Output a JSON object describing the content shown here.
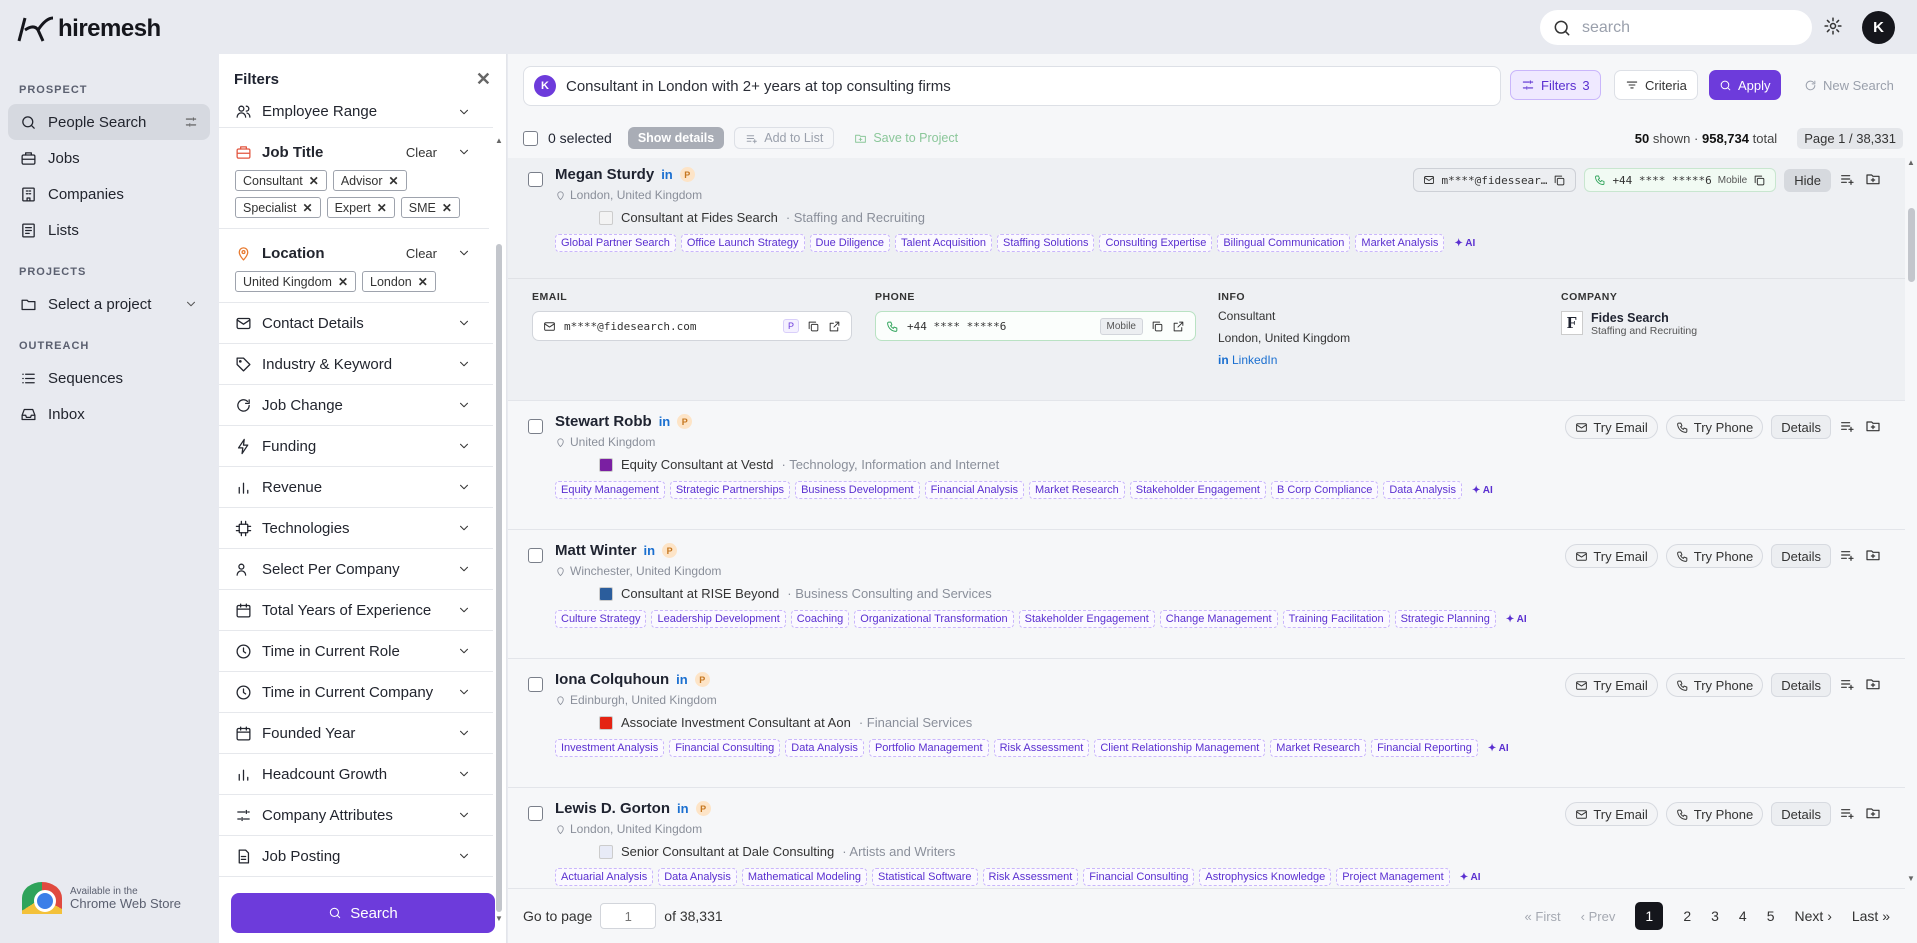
{
  "app": {
    "brand": "hiremesh",
    "avatar_initial": "K",
    "search_placeholder": "search"
  },
  "nav": {
    "sections": [
      {
        "title": "PROSPECT",
        "items": [
          "People Search",
          "Jobs",
          "Companies",
          "Lists"
        ]
      },
      {
        "title": "PROJECTS",
        "items": [
          "Select a project"
        ]
      },
      {
        "title": "OUTREACH",
        "items": [
          "Sequences",
          "Inbox"
        ]
      }
    ],
    "chrome_line1": "Available in the",
    "chrome_line2": "Chrome Web Store"
  },
  "filters": {
    "title": "Filters",
    "employee_range": "Employee Range",
    "job_title": {
      "label": "Job Title",
      "clear": "Clear",
      "chips": [
        "Consultant",
        "Advisor",
        "Specialist",
        "Expert",
        "SME"
      ]
    },
    "location": {
      "label": "Location",
      "clear": "Clear",
      "chips": [
        "United Kingdom",
        "London"
      ]
    },
    "rows": [
      "Contact Details",
      "Industry & Keyword",
      "Job Change",
      "Funding",
      "Revenue",
      "Technologies",
      "Select Per Company",
      "Total Years of Experience",
      "Time in Current Role",
      "Time in Current Company",
      "Founded Year",
      "Headcount Growth",
      "Company Attributes",
      "Job Posting"
    ],
    "search_button": "Search"
  },
  "query": {
    "initial": "K",
    "text": "Consultant in London with 2+ years at top consulting firms"
  },
  "actions": {
    "filters_label": "Filters",
    "filters_count": "3",
    "criteria": "Criteria",
    "apply": "Apply",
    "new_search": "New Search"
  },
  "toolbar": {
    "selected": "0 selected",
    "show_details": "Show details",
    "add_to_list": "Add to List",
    "save_to_project": "Save to Project",
    "shown": "50",
    "shown_suffix": "shown ·",
    "total": "958,734",
    "total_suffix": "total",
    "page": "Page 1 / 38,331"
  },
  "people": [
    {
      "name": "Megan Sturdy",
      "location": "London, United Kingdom",
      "role": "Consultant at Fides Search",
      "industry": "· Staffing and Recruiting",
      "tags": [
        "Global Partner Search",
        "Office Launch Strategy",
        "Due Diligence",
        "Talent Acquisition",
        "Staffing Solutions",
        "Consulting Expertise",
        "Bilingual Communication",
        "Market Analysis"
      ],
      "email": "m****@fidessear…",
      "phone": "+44 **** *****6",
      "phone_type": "Mobile",
      "hide": "Hide",
      "detail": {
        "email_label": "EMAIL",
        "email": "m****@fidesearch.com",
        "email_badge": "P",
        "phone_label": "PHONE",
        "phone": "+44 **** *****6",
        "phone_type": "Mobile",
        "info_label": "INFO",
        "info_title": "Consultant",
        "info_location": "London, United Kingdom",
        "info_link": "LinkedIn",
        "company_label": "COMPANY",
        "company_letter": "F",
        "company_name": "Fides Search",
        "company_industry": "Staffing and Recruiting"
      }
    },
    {
      "name": "Stewart Robb",
      "location": "United Kingdom",
      "role": "Equity Consultant at Vestd",
      "industry": "· Technology, Information and Internet",
      "tags": [
        "Equity Management",
        "Strategic Partnerships",
        "Business Development",
        "Financial Analysis",
        "Market Research",
        "Stakeholder Engagement",
        "B Corp Compliance",
        "Data Analysis"
      ]
    },
    {
      "name": "Matt Winter",
      "location": "Winchester, United Kingdom",
      "role": "Consultant at RISE Beyond",
      "industry": "· Business Consulting and Services",
      "tags": [
        "Culture Strategy",
        "Leadership Development",
        "Coaching",
        "Organizational Transformation",
        "Stakeholder Engagement",
        "Change Management",
        "Training Facilitation",
        "Strategic Planning"
      ]
    },
    {
      "name": "Iona Colquhoun",
      "location": "Edinburgh, United Kingdom",
      "role": "Associate Investment Consultant at Aon",
      "industry": "· Financial Services",
      "tags": [
        "Investment Analysis",
        "Financial Consulting",
        "Data Analysis",
        "Portfolio Management",
        "Risk Assessment",
        "Client Relationship Management",
        "Market Research",
        "Financial Reporting"
      ]
    },
    {
      "name": "Lewis D. Gorton",
      "location": "London, United Kingdom",
      "role": "Senior Consultant at Dale Consulting",
      "industry": "· Artists and Writers",
      "tags": [
        "Actuarial Analysis",
        "Data Analysis",
        "Mathematical Modeling",
        "Statistical Software",
        "Risk Assessment",
        "Financial Consulting",
        "Astrophysics Knowledge",
        "Project Management"
      ]
    }
  ],
  "card_labels": {
    "li": "in",
    "p": "P",
    "ai": "✦ AI",
    "try_email": "Try Email",
    "try_phone": "Try Phone",
    "details": "Details"
  },
  "colors": {
    "accent": "#6d3bdb",
    "logos": [
      "#f3f3f3",
      "#7a1fa2",
      "#2b5d9c",
      "#e42313",
      "#e8ebf7"
    ]
  },
  "pager": {
    "goto": "Go to page",
    "input_placeholder": "1",
    "of": "of 38,331",
    "first": "« First",
    "prev": "‹ Prev",
    "pages": [
      "1",
      "2",
      "3",
      "4",
      "5"
    ],
    "next": "Next ›",
    "last": "Last »"
  }
}
